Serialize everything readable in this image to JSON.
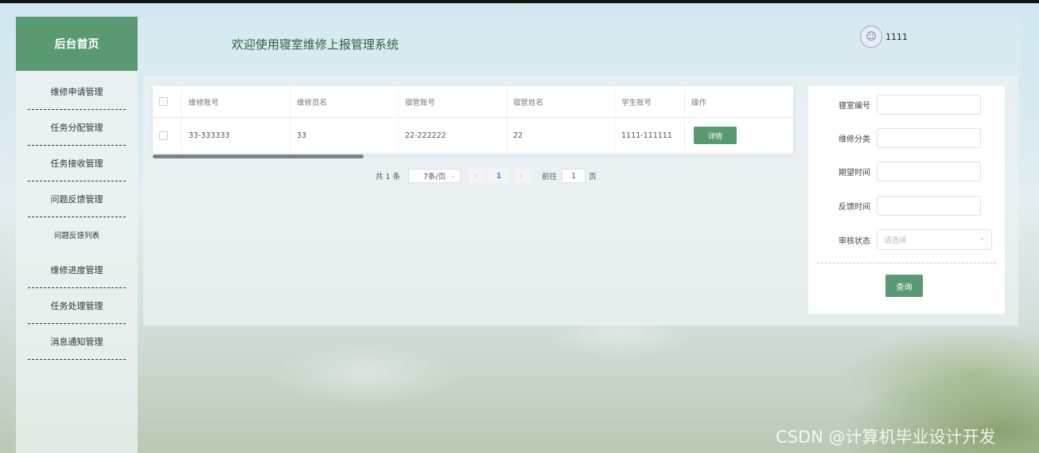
{
  "sidebar": {
    "logo": "后台首页",
    "items": [
      {
        "label": "维修申请管理"
      },
      {
        "label": "任务分配管理"
      },
      {
        "label": "任务接收管理"
      },
      {
        "label": "问题反馈管理"
      },
      {
        "label": "问题反馈列表"
      },
      {
        "label": "维修进度管理"
      },
      {
        "label": "任务处理管理"
      },
      {
        "label": "消息通知管理"
      }
    ]
  },
  "header": {
    "welcome": "欢迎使用寝室维修上报管理系统",
    "username": "1111"
  },
  "table": {
    "columns": [
      "维修账号",
      "维修员名",
      "宿管账号",
      "宿管姓名",
      "学生账号",
      "操作"
    ],
    "rows": [
      {
        "cells": [
          "33-333333",
          "33",
          "22-222222",
          "22",
          "1111-111111"
        ],
        "action": "详情"
      }
    ]
  },
  "pager": {
    "total": "共 1 条",
    "page_size": "7条/页",
    "current": "1",
    "goto_label": "前往",
    "goto_value": "1",
    "page_unit": "页"
  },
  "search": {
    "fields": [
      {
        "label": "寝室编号",
        "value": ""
      },
      {
        "label": "维修分类",
        "value": ""
      },
      {
        "label": "期望时间",
        "value": ""
      },
      {
        "label": "反馈时间",
        "value": ""
      }
    ],
    "status_label": "审核状态",
    "status_placeholder": "请选择",
    "query_label": "查询"
  },
  "watermark": "CSDN @计算机毕业设计开发",
  "colors": {
    "accent": "#5a9a72"
  }
}
